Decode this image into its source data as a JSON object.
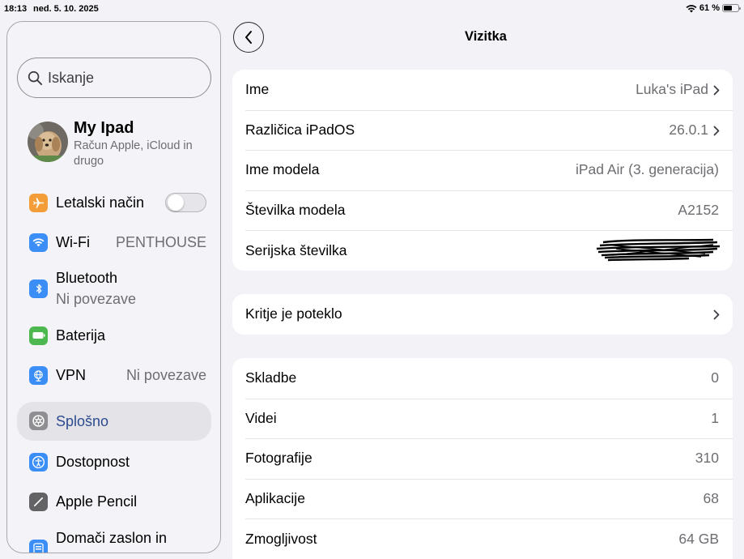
{
  "status_bar": {
    "time": "18:13",
    "date": "ned. 5. 10. 2025",
    "battery": "61 %",
    "battery_level": 0.61
  },
  "sidebar": {
    "search_placeholder": "Iskanje",
    "profile": {
      "name": "My Ipad",
      "subtitle": "Račun Apple, iCloud in drugo"
    },
    "items": [
      {
        "label": "Letalski način",
        "icon": "airplane-icon",
        "color": "#f29d38",
        "toggle": false
      },
      {
        "label": "Wi-Fi",
        "value": "PENTHOUSE",
        "icon": "wifi-icon",
        "color": "#3a8ef6"
      },
      {
        "label": "Bluetooth",
        "sublabel": "Ni povezave",
        "icon": "bluetooth-icon",
        "color": "#3a8ef6"
      },
      {
        "label": "Baterija",
        "icon": "battery-icon",
        "color": "#4cb84f"
      },
      {
        "label": "VPN",
        "value": "Ni povezave",
        "icon": "globe-icon",
        "color": "#3a8ef6"
      },
      {
        "label": "Splošno",
        "icon": "gear-icon",
        "color": "#8e8e93",
        "selected": true
      },
      {
        "label": "Dostopnost",
        "icon": "accessibility-icon",
        "color": "#3a8ef6"
      },
      {
        "label": "Apple Pencil",
        "icon": "pencil-icon",
        "color": "#636366"
      },
      {
        "label": "Domači zaslon in",
        "icon": "home-screen-icon",
        "color": "#3a8ef6"
      }
    ]
  },
  "main": {
    "title": "Vizitka",
    "group1": [
      {
        "label": "Ime",
        "value": "Luka's iPad",
        "chevron": true
      },
      {
        "label": "Različica iPadOS",
        "value": "26.0.1",
        "chevron": true
      },
      {
        "label": "Ime modela",
        "value": "iPad Air (3. generacija)",
        "chevron": false
      },
      {
        "label": "Številka modela",
        "value": "A2152",
        "chevron": false
      },
      {
        "label": "Serijska številka",
        "value": "",
        "redacted": true
      }
    ],
    "group2": [
      {
        "label": "Kritje je poteklo",
        "chevron": true
      }
    ],
    "group3": [
      {
        "label": "Skladbe",
        "value": "0"
      },
      {
        "label": "Videi",
        "value": "1"
      },
      {
        "label": "Fotografije",
        "value": "310"
      },
      {
        "label": "Aplikacije",
        "value": "68"
      },
      {
        "label": "Zmogljivost",
        "value": "64 GB"
      }
    ]
  }
}
